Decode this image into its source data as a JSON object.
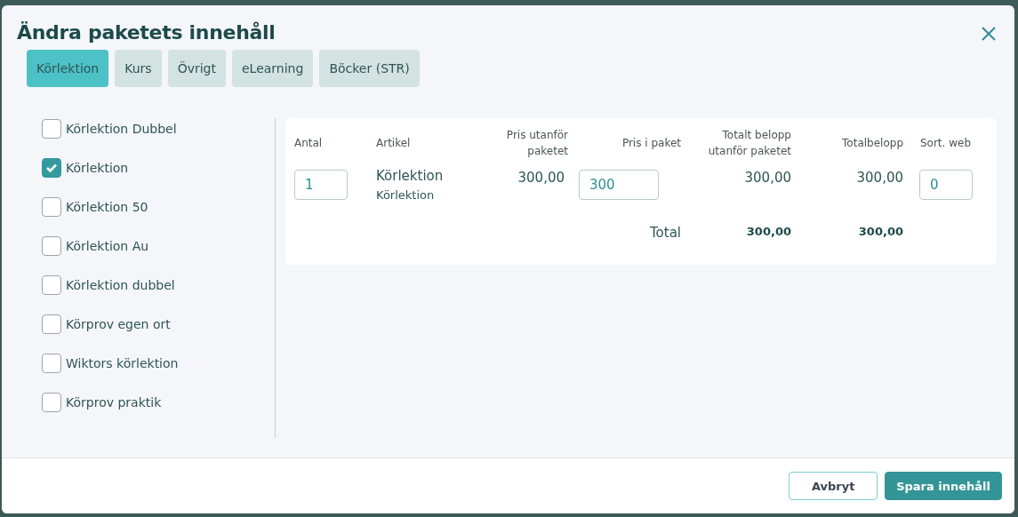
{
  "dialog": {
    "title": "Ändra paketets innehåll"
  },
  "tabs": [
    {
      "label": "Körlektion",
      "selected": true
    },
    {
      "label": "Kurs",
      "selected": false
    },
    {
      "label": "Övrigt",
      "selected": false
    },
    {
      "label": "eLearning",
      "selected": false
    },
    {
      "label": "Böcker (STR)",
      "selected": false
    }
  ],
  "items": [
    {
      "label": "Körlektion Dubbel",
      "checked": false
    },
    {
      "label": "Körlektion",
      "checked": true
    },
    {
      "label": "Körlektion 50",
      "checked": false
    },
    {
      "label": "Körlektion Au",
      "checked": false
    },
    {
      "label": "Körlektion dubbel",
      "checked": false
    },
    {
      "label": "Körprov egen ort",
      "checked": false
    },
    {
      "label": "Wiktors körlektion",
      "checked": false
    },
    {
      "label": "Körprov praktik",
      "checked": false
    }
  ],
  "table": {
    "columns": [
      "Antal",
      "Artikel",
      "Pris utanför paketet",
      "Pris i paket",
      "Totalt belopp utanför paketet",
      "Totalbelopp",
      "Sort. web"
    ],
    "rows": [
      {
        "quantity": "1",
        "article": "Körlektion",
        "article_sub": "Körlektion",
        "price_outside": "300,00",
        "price_in_package": "300",
        "total_outside": "300,00",
        "total": "300,00",
        "sort": "0"
      }
    ],
    "footer": {
      "label": "Total",
      "total_outside": "300,00",
      "total": "300,00"
    }
  },
  "buttons": [
    {
      "label": "Avbryt",
      "kind": "secondary"
    },
    {
      "label": "Spara innehåll",
      "kind": "primary"
    }
  ]
}
